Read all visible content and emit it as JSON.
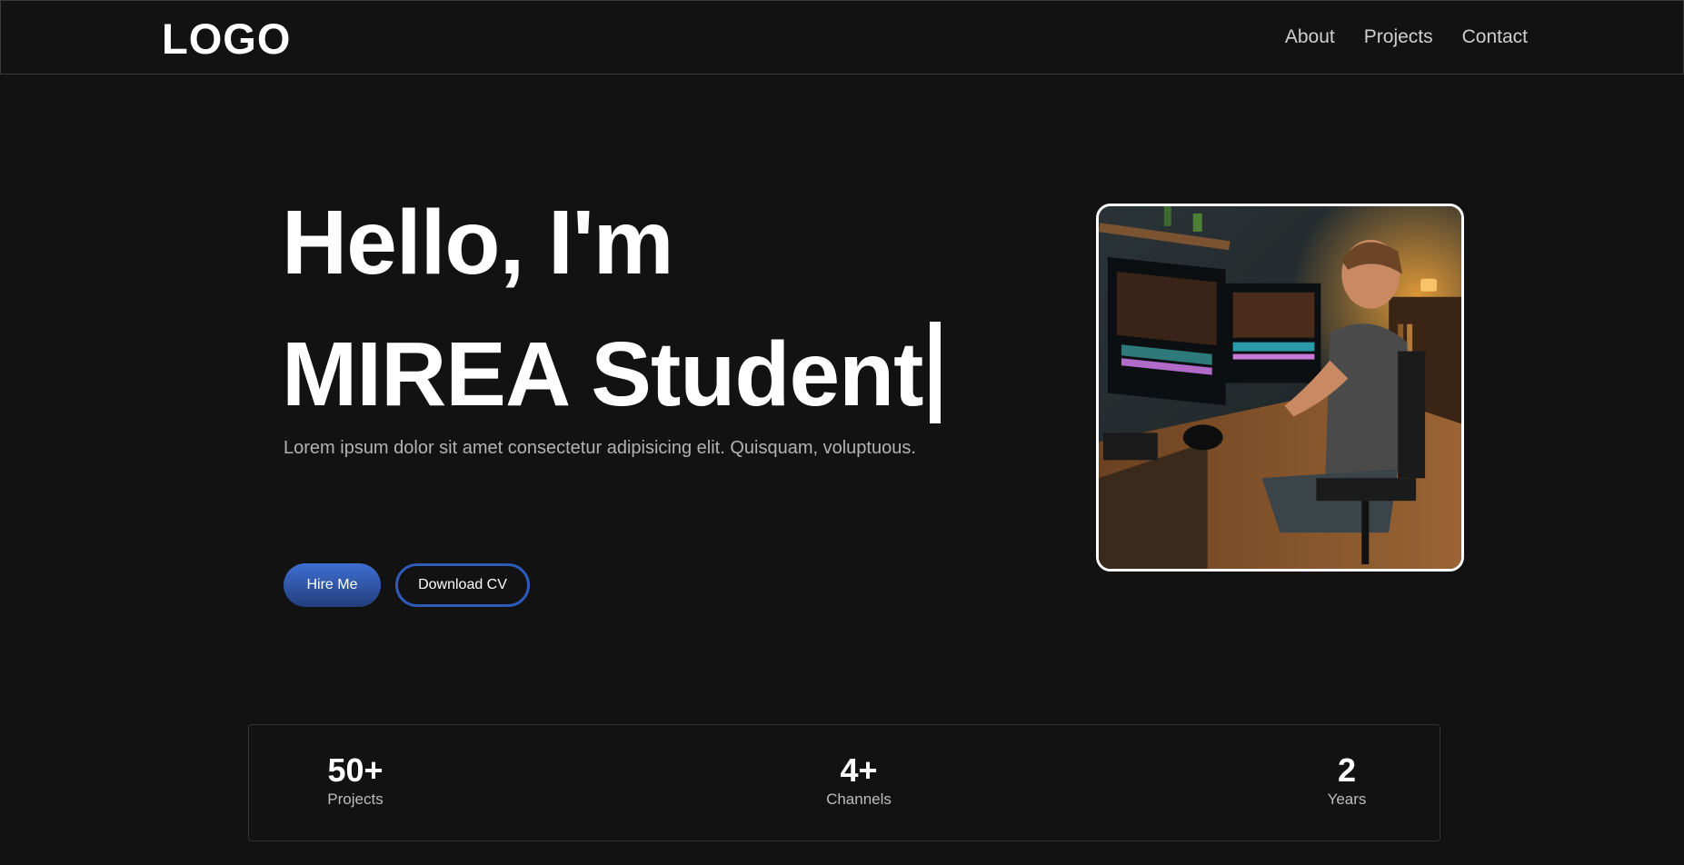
{
  "header": {
    "logo": "LOGO",
    "nav": [
      {
        "label": "About"
      },
      {
        "label": "Projects"
      },
      {
        "label": "Contact"
      }
    ]
  },
  "hero": {
    "line1": "Hello, I'm",
    "line2": "MIREA Student",
    "description": "Lorem ipsum dolor sit amet consectetur adipisicing elit. Quisquam, voluptuous.",
    "primary_button": "Hire Me",
    "secondary_button": "Download CV",
    "image_subject": "video-editor-at-desk"
  },
  "stats": [
    {
      "value": "50+",
      "label": "Projects"
    },
    {
      "value": "4+",
      "label": "Channels"
    },
    {
      "value": "2",
      "label": "Years"
    }
  ],
  "colors": {
    "background": "#121212",
    "accent": "#3e6fd2",
    "text": "#ffffff",
    "muted": "#b3b3b3"
  }
}
